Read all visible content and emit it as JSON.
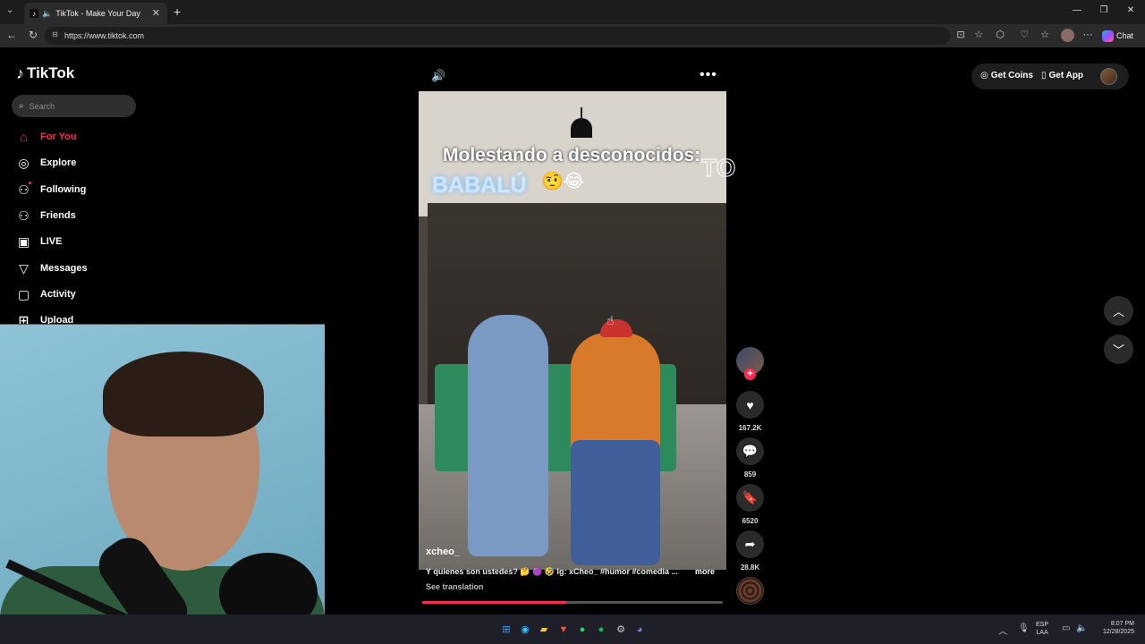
{
  "browser": {
    "tab_title": "TikTok - Make Your Day",
    "tab_close": "✕",
    "new_tab": "+",
    "url": "https://www.tiktok.com",
    "chat_label": "Chat",
    "window_controls": [
      "—",
      "❐",
      "✕"
    ]
  },
  "sidebar": {
    "logo_text": "TikTok",
    "search_placeholder": "Search",
    "items": [
      {
        "label": "For You",
        "icon": "home-icon",
        "glyph": "⌂"
      },
      {
        "label": "Explore",
        "icon": "compass-icon",
        "glyph": "◎"
      },
      {
        "label": "Following",
        "icon": "following-icon",
        "glyph": "⚇"
      },
      {
        "label": "Friends",
        "icon": "friends-icon",
        "glyph": "⚇"
      },
      {
        "label": "LIVE",
        "icon": "live-icon",
        "glyph": "▣"
      },
      {
        "label": "Messages",
        "icon": "messages-icon",
        "glyph": "▽"
      },
      {
        "label": "Activity",
        "icon": "activity-icon",
        "glyph": "▢"
      },
      {
        "label": "Upload",
        "icon": "upload-icon",
        "glyph": "⊞"
      }
    ]
  },
  "video": {
    "overlay_line1": "Molestando a desconocidos:",
    "overlay_line1_tail": "TO",
    "overlay_line2": "BABALÚ",
    "overlay_emojis": "🤨😂",
    "username": "xcheo_",
    "description": "Y quienes son ustedes? 🤔 🟣 🤣 Ig: xCheo_ #humor #comedia ...",
    "more": "more",
    "see_translation": "See translation",
    "progress": 0.48
  },
  "actions": {
    "likes": "167.2K",
    "comments": "859",
    "saves": "6520",
    "shares": "28.8K"
  },
  "header": {
    "get_coins": "Get Coins",
    "get_app": "Get App"
  },
  "taskbar": {
    "lang_line1": "ESP",
    "lang_line2": "LAA",
    "time": "8:07 PM",
    "date": "12/28/2025"
  },
  "colors": {
    "accent": "#fe2c55",
    "background": "#000000"
  }
}
